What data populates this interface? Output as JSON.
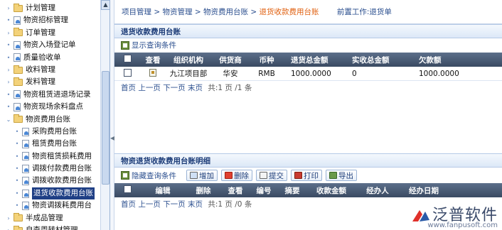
{
  "sidebar": {
    "items": [
      {
        "label": "计划管理",
        "type": "folder",
        "state": "collapsed"
      },
      {
        "label": "物资招标管理",
        "type": "doc"
      },
      {
        "label": "订单管理",
        "type": "folder",
        "state": "collapsed"
      },
      {
        "label": "物资入场登记单",
        "type": "doc"
      },
      {
        "label": "质量验收单",
        "type": "doc"
      },
      {
        "label": "收料管理",
        "type": "folder",
        "state": "collapsed"
      },
      {
        "label": "发料管理",
        "type": "folder",
        "state": "collapsed"
      },
      {
        "label": "物资租赁进退场记录",
        "type": "doc"
      },
      {
        "label": "物资现场余料盘点",
        "type": "doc"
      },
      {
        "label": "物资费用台账",
        "type": "folder",
        "state": "expanded"
      },
      {
        "label": "采购费用台账",
        "type": "doc",
        "child": true
      },
      {
        "label": "租赁费用台账",
        "type": "doc",
        "child": true
      },
      {
        "label": "物资租赁损耗费用",
        "type": "doc",
        "child": true
      },
      {
        "label": "调拨付款费用台账",
        "type": "doc",
        "child": true
      },
      {
        "label": "调拨收款费用台账",
        "type": "doc",
        "child": true
      },
      {
        "label": "退货收款费用台账",
        "type": "doc",
        "child": true,
        "selected": true
      },
      {
        "label": "物资调拨耗费用台",
        "type": "doc",
        "child": true
      },
      {
        "label": "半成品管理",
        "type": "folder",
        "state": "collapsed"
      },
      {
        "label": "自查周转材管理",
        "type": "folder",
        "state": "collapsed"
      }
    ]
  },
  "breadcrumb": {
    "items": [
      "项目管理",
      "物资管理",
      "物资费用台账"
    ],
    "current": "退货收款费用台账",
    "separator": ">",
    "pre_work": "前置工作:退货单"
  },
  "top_panel": {
    "title": "退货收款费用台账",
    "show_query": "显示查询条件",
    "columns": [
      "查看",
      "组织机构",
      "供货商",
      "币种",
      "退货总金额",
      "实收总金额",
      "欠款额"
    ],
    "rows": [
      {
        "org": "九江项目部",
        "supplier": "华安",
        "currency": "RMB",
        "return_total": "1000.0000",
        "received_total": "0",
        "owed": "1000.0000"
      }
    ],
    "pager": {
      "first": "首页",
      "prev": "上一页",
      "next": "下一页",
      "last": "末页",
      "total": "共:1 页 /1 条"
    }
  },
  "bottom_panel": {
    "title": "物资退货收款费用台账明细",
    "hide_query": "隐藏查询条件",
    "buttons": {
      "add": "增加",
      "delete": "删除",
      "submit": "提交",
      "print": "打印",
      "export": "导出"
    },
    "columns": [
      "编辑",
      "删除",
      "查看",
      "编号",
      "摘要",
      "收款金额",
      "经办人",
      "经办日期"
    ],
    "pager": {
      "first": "首页",
      "prev": "上一页",
      "next": "下一页",
      "last": "末页",
      "total": "共:1 页 /0 条"
    }
  },
  "watermark": {
    "name": "泛普软件",
    "url": "www.fanpusoft.com"
  },
  "colors": {
    "accent": "#1c3c78",
    "grid_header": "#3a4a62",
    "selected": "#1f3f85",
    "current_crumb": "#e06010"
  }
}
